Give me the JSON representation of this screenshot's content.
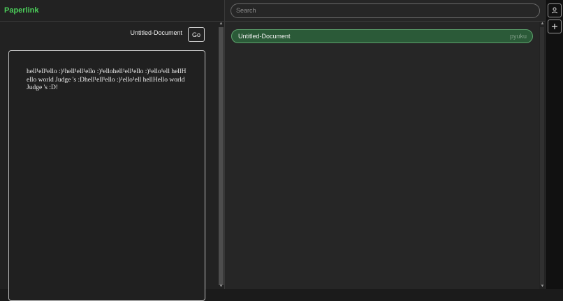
{
  "app": {
    "title": "Paperlink"
  },
  "editor": {
    "document_title": "Untitled-Document",
    "go_label": "Go",
    "content": "hell¹ell¹ello :)¹hell¹ell¹ello :)¹ellohell¹ell¹ello :)¹ello¹ell hellHello world Judge 's :Dhell¹ell¹ello :)¹ello¹ell hellHello world Judge 's :D!"
  },
  "search": {
    "placeholder": "Search"
  },
  "documents": [
    {
      "name": "Untitled-Document",
      "owner": "pyuku"
    }
  ],
  "toolbar": {
    "icons": [
      "user-icon",
      "plus-icon"
    ]
  },
  "colors": {
    "brand": "#4cd15b",
    "selected_item_bg": "#2b5a38",
    "selected_item_border": "#5da36d"
  }
}
